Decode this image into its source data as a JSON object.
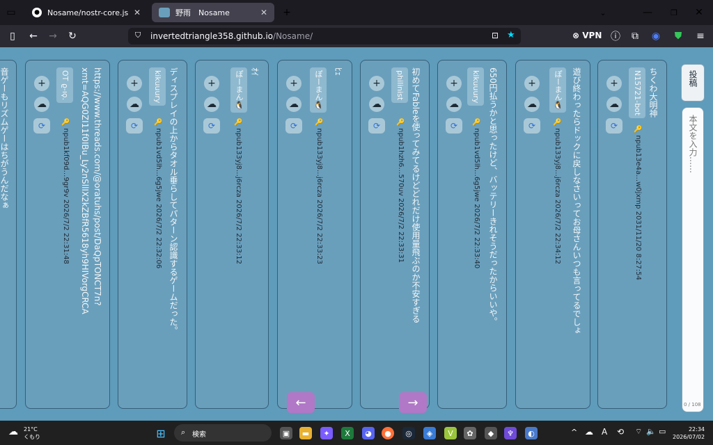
{
  "browser": {
    "tabs": [
      {
        "title": "Nosame/nostr-core.js at main · in"
      },
      {
        "title": "野雨　Nosame"
      }
    ],
    "url_host": "invertedtriangle358.github.io",
    "url_path": "/Nosame/",
    "vpn_label": "VPN"
  },
  "app": {
    "post_button_label": "投稿",
    "input_placeholder": "本文を入力……",
    "char_count": "0 / 108",
    "nav_prev": "←",
    "nav_next": "→",
    "columns": [
      {
        "body": "ちくわ大明神",
        "name": "N15721-bot",
        "npub": "npub13e4a…w0jxmp",
        "time": "2031/11/20 8:27:54"
      },
      {
        "body": "遊び終わったらドックに戻しなさいってお母さんいつも言ってるでしょ",
        "name": "ぽーまん🐧",
        "npub": "npub133yj8…j6rcza",
        "time": "2026/7/2 22:34:12"
      },
      {
        "body": "650円払うかと思ったけど、バッテリーきれそうだったからいいや。",
        "name": "kikuuury",
        "npub": "npub1vd5lh…6g5jwe",
        "time": "2026/7/2 22:33:40"
      },
      {
        "body": "初めてFableを使ってみてるけどどれだけ使用量飛ぶのか不安すぎる",
        "name": "philinist",
        "npub": "npub1hzh6…570uv",
        "time": "2026/7/2 22:33:31"
      },
      {
        "body": "ﾋｪ",
        "name": "ぽーまん🐧",
        "npub": "npub133yj8…j6rcza",
        "time": "2026/7/2 22:33:23"
      },
      {
        "body": "ｵｲ",
        "name": "ぽーまん🐧",
        "npub": "npub133yj8…j6rcza",
        "time": "2026/7/2 22:33:12"
      },
      {
        "body": "ディスプレイの上からタオル垂らしてパターン認識するゲームだった。",
        "name": "kikuuury",
        "npub": "npub1vd5lh…6g5jwe",
        "time": "2026/7/2 22:32:06"
      },
      {
        "body": "https://www.threads.com/@oratuhs/post/DaQpTONCT7n?xmt=AQG0ZI11f0IBu_Ly2nSllIX2kZBfR5618yh9HIVorgCRCA",
        "name": "OT ϱ-ıϙ.",
        "npub": "npub1kf09d…9gr9v",
        "time": "2026/7/2 22:31:48"
      },
      {
        "body": "音ゲーもリズムゲーはちがうんだなぁ"
      }
    ]
  },
  "taskbar": {
    "weather_temp": "21°C",
    "weather_desc": "くもり",
    "search_label": "検索",
    "time": "22:34",
    "date": "2026/07/02",
    "ime": "A"
  }
}
